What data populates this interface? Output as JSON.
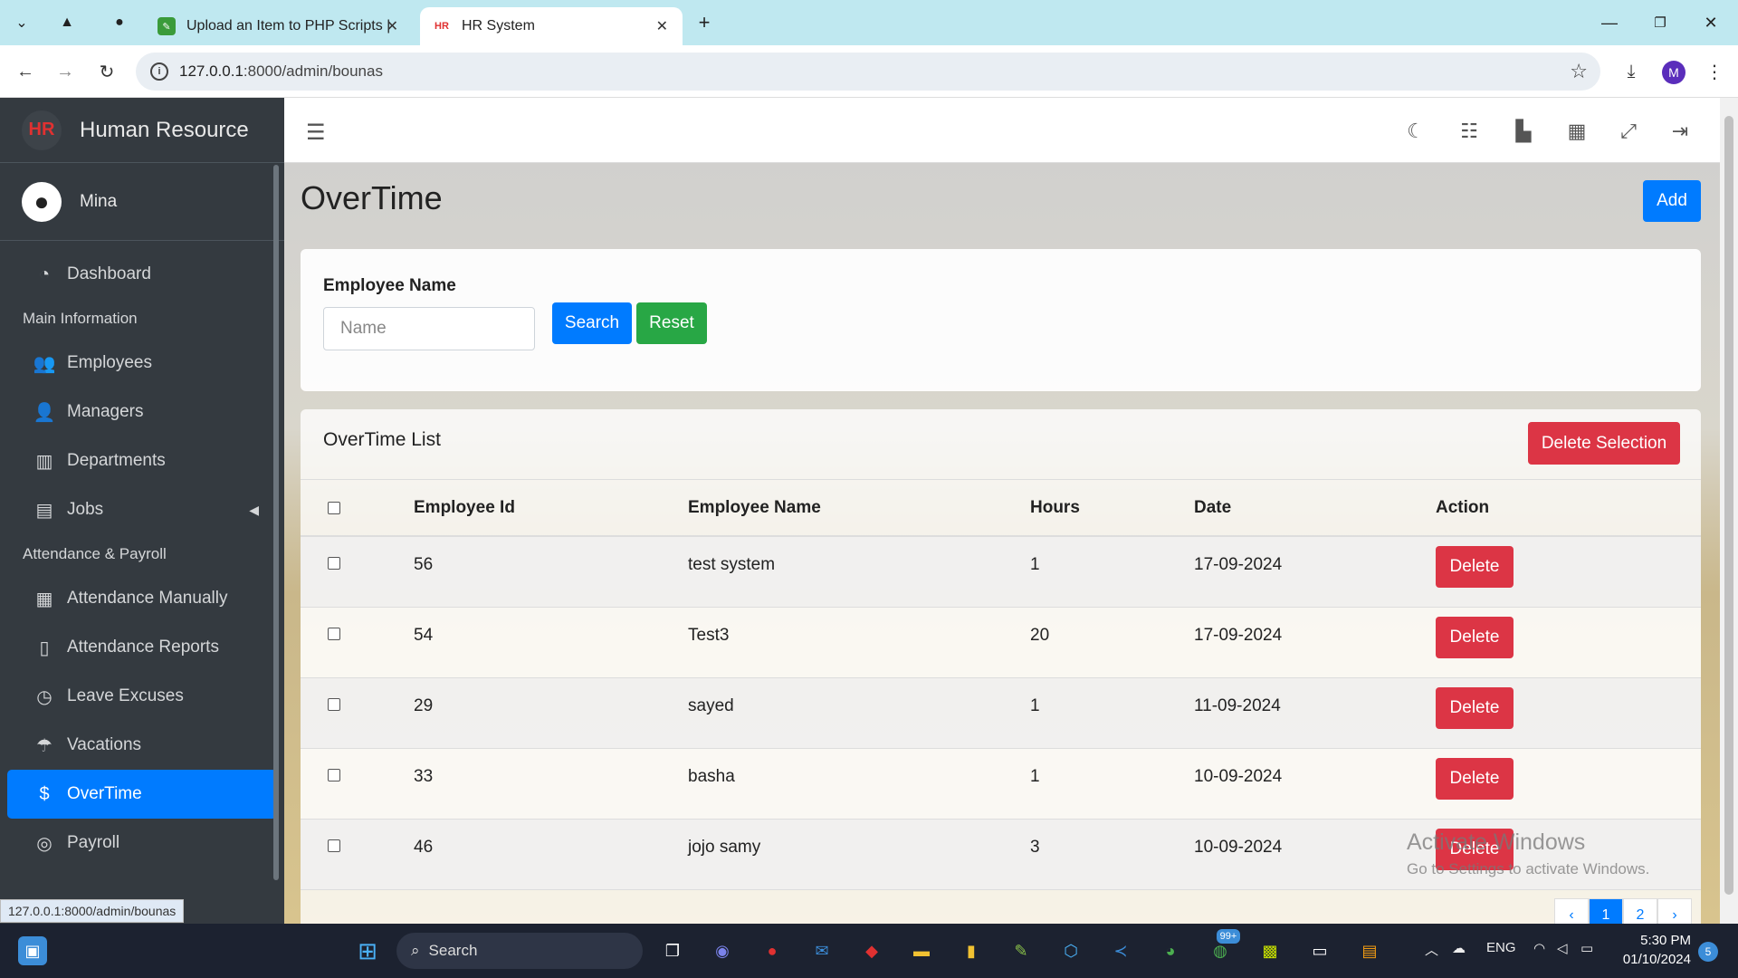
{
  "browser": {
    "tabs": [
      {
        "title": "Upload an Item to PHP Scripts |"
      },
      {
        "title": "HR System"
      }
    ],
    "url_host": "127.0.0.1",
    "url_path": ":8000/admin/bounas",
    "profile_initial": "M",
    "status_url": "127.0.0.1:8000/admin/bounas"
  },
  "sidebar": {
    "brand": "Human Resource",
    "brand_logo": "HR",
    "user_name": "Mina",
    "items": [
      {
        "label": "Dashboard",
        "icon": "tachometer-icon"
      },
      {
        "header": "Main Information"
      },
      {
        "label": "Employees",
        "icon": "users-icon"
      },
      {
        "label": "Managers",
        "icon": "user-icon"
      },
      {
        "label": "Departments",
        "icon": "building-icon"
      },
      {
        "label": "Jobs",
        "icon": "briefcase-icon"
      },
      {
        "header": "Attendance & Payroll"
      },
      {
        "label": "Attendance Manually",
        "icon": "calendar-icon"
      },
      {
        "label": "Attendance Reports",
        "icon": "file-icon"
      },
      {
        "label": "Leave Excuses",
        "icon": "clock-icon"
      },
      {
        "label": "Vacations",
        "icon": "umbrella-beach-icon"
      },
      {
        "label": "OverTime",
        "icon": "dollar-icon"
      },
      {
        "label": "Payroll",
        "icon": "coins-icon"
      }
    ]
  },
  "page": {
    "title": "OverTime",
    "add_label": "Add",
    "filter": {
      "label": "Employee Name",
      "placeholder": "Name",
      "search_label": "Search",
      "reset_label": "Reset"
    },
    "list": {
      "title": "OverTime List",
      "delete_selection_label": "Delete Selection",
      "columns": [
        "Employee Id",
        "Employee Name",
        "Hours",
        "Date",
        "Action"
      ],
      "rows": [
        {
          "id": "56",
          "name": "test system",
          "hours": "1",
          "date": "17-09-2024",
          "action": "Delete"
        },
        {
          "id": "54",
          "name": "Test3",
          "hours": "20",
          "date": "17-09-2024",
          "action": "Delete"
        },
        {
          "id": "29",
          "name": "sayed",
          "hours": "1",
          "date": "11-09-2024",
          "action": "Delete"
        },
        {
          "id": "33",
          "name": "basha",
          "hours": "1",
          "date": "10-09-2024",
          "action": "Delete"
        },
        {
          "id": "46",
          "name": "jojo samy",
          "hours": "3",
          "date": "10-09-2024",
          "action": "Delete"
        }
      ]
    },
    "pagination": [
      "‹",
      "1",
      "2",
      "›"
    ],
    "watermark": {
      "line1": "Activate Windows",
      "line2": "Go to Settings to activate Windows."
    }
  },
  "taskbar": {
    "search_label": "Search",
    "language": "ENG",
    "time": "5:30 PM",
    "date": "01/10/2024",
    "notifications": "5",
    "whatsapp_badge": "99+"
  },
  "colors": {
    "primary": "#007bff",
    "success": "#28a745",
    "danger": "#dc3545",
    "sidebar": "#343a40"
  }
}
